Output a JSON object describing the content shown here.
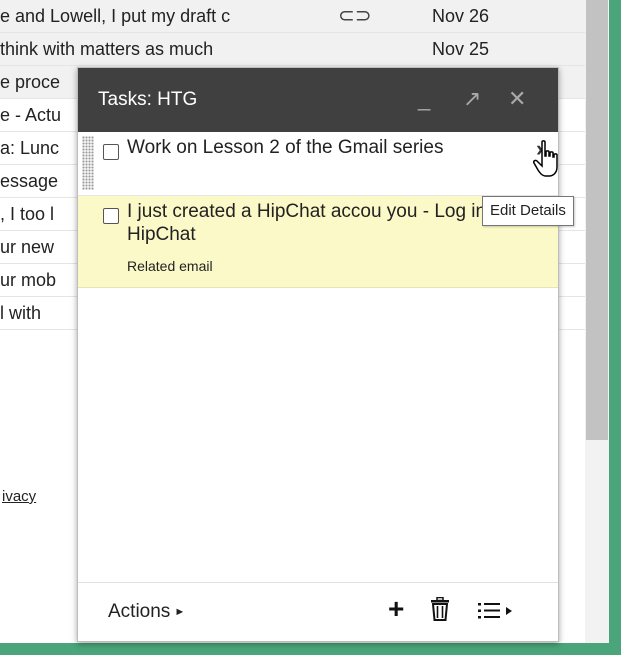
{
  "background": {
    "rows": [
      {
        "subject": "e and Lowell, I put my draft c",
        "date": "Nov 26",
        "read": true,
        "attachment": true
      },
      {
        "subject": "think with matters as much",
        "date": "Nov 25",
        "read": true,
        "attachment": false
      },
      {
        "subject": "e proce",
        "date": "",
        "read": true,
        "attachment": false
      },
      {
        "subject": "e - Actu",
        "date": "",
        "read": false,
        "attachment": false
      },
      {
        "subject": "a: Lunc",
        "date": "",
        "read": false,
        "attachment": false
      },
      {
        "subject": "essage",
        "date": "",
        "read": false,
        "attachment": false
      },
      {
        "subject": ", I too l",
        "date": "",
        "read": false,
        "attachment": false
      },
      {
        "subject": "ur new",
        "date": "",
        "read": false,
        "attachment": false
      },
      {
        "subject": "ur mob",
        "date": "",
        "read": false,
        "attachment": false
      },
      {
        "subject": "l with",
        "date": "",
        "read": false,
        "attachment": false
      }
    ],
    "privacy_link": "ivacy"
  },
  "tasks": {
    "title": "Tasks: HTG",
    "controls": {
      "minimize": "_",
      "popout": "↗",
      "close": "✕"
    },
    "items": [
      {
        "text": "Work on Lesson 2 of the Gmail series",
        "related": "",
        "checked": false
      },
      {
        "text": "I just created a HipChat accou you - Log in to HipChat",
        "related": "Related email",
        "checked": false
      }
    ],
    "edit_arrow": "›",
    "tooltip": "Edit Details",
    "footer": {
      "actions_label": "Actions",
      "actions_arrow": "►",
      "add_icon": "+"
    }
  },
  "colors": {
    "titlebar": "#404040",
    "highlight_row": "#fbf9c8",
    "frame": "#4aa57a"
  }
}
